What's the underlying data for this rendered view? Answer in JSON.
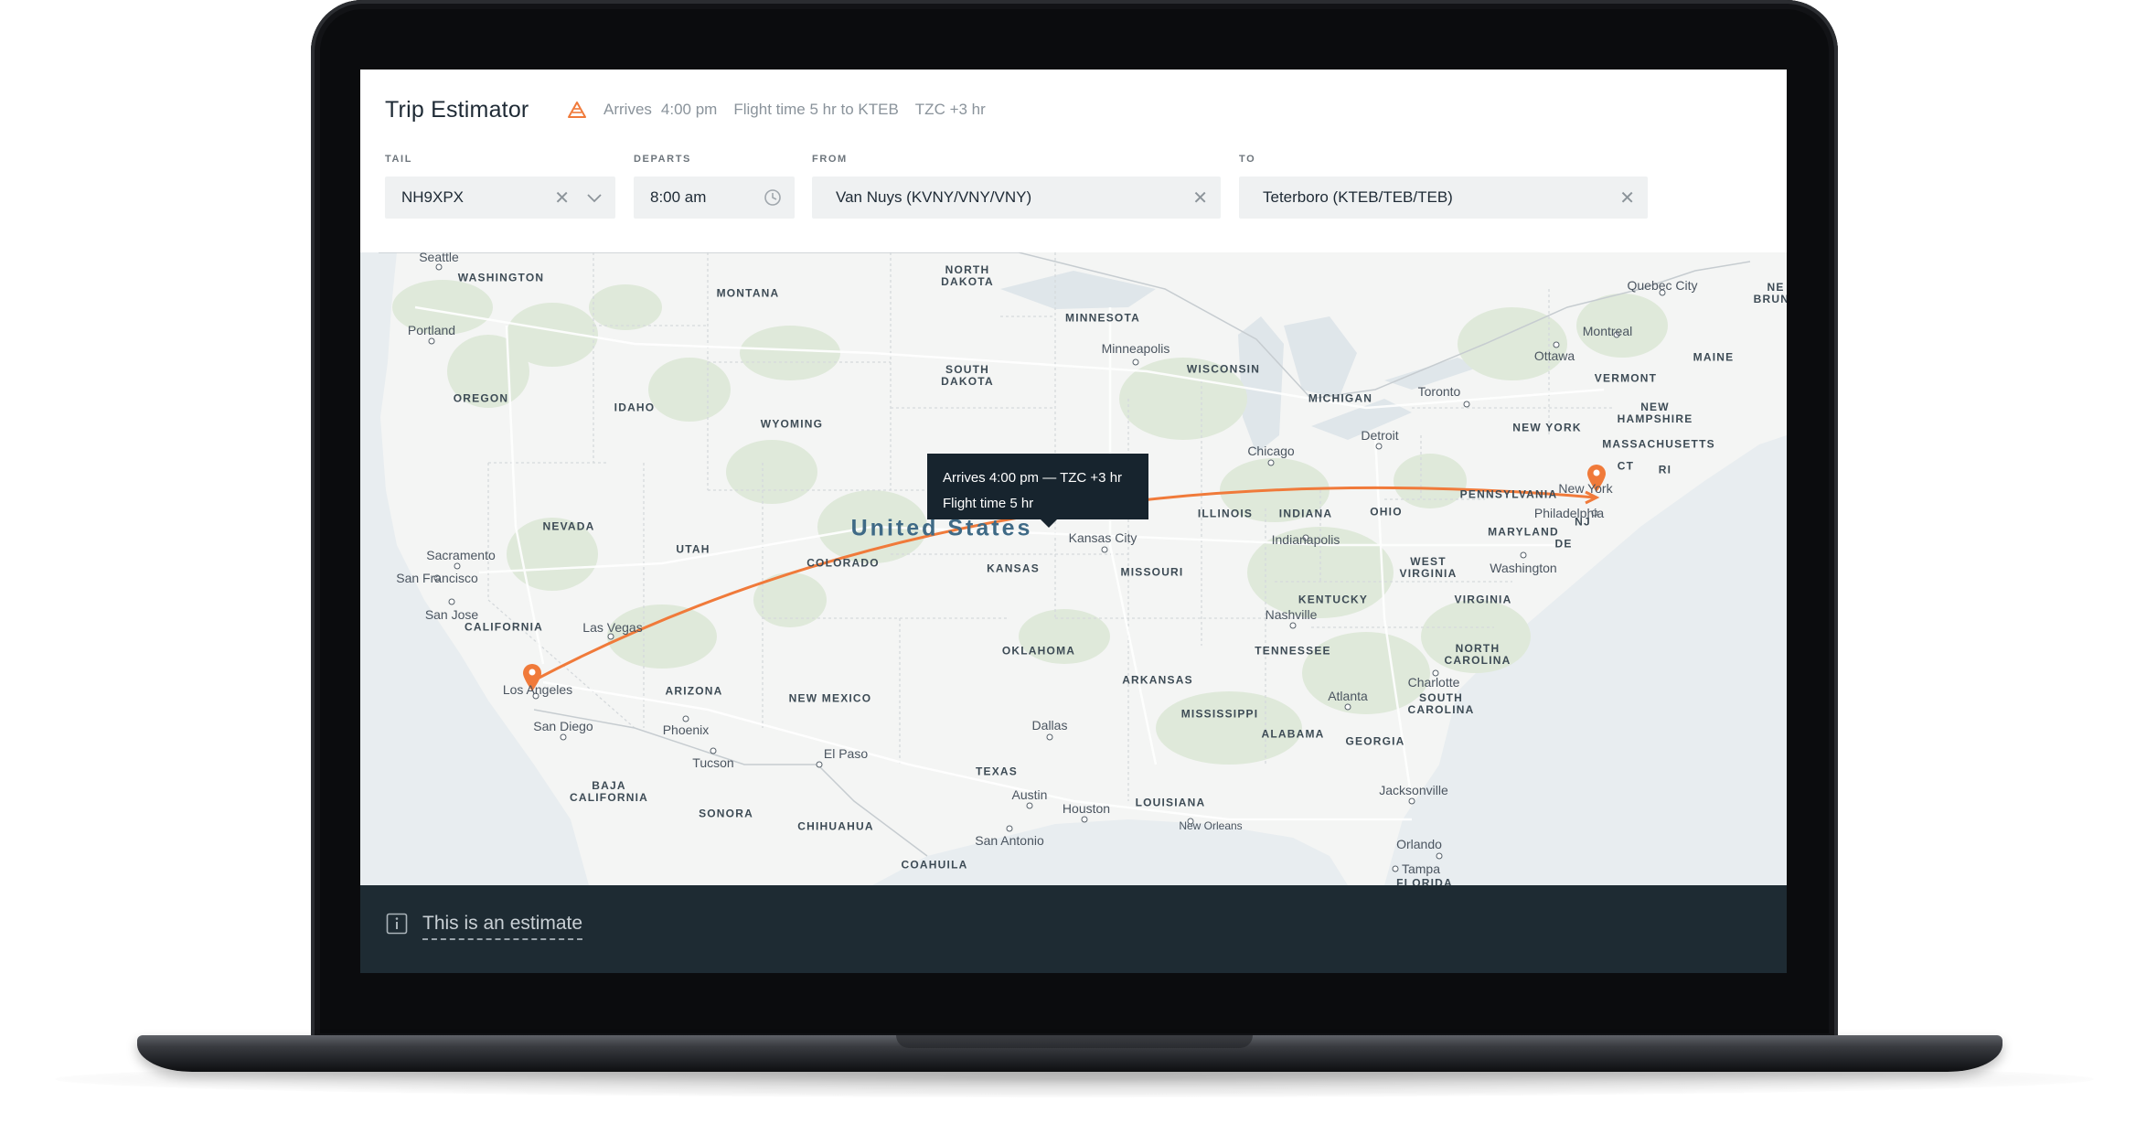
{
  "app": {
    "title": "Trip Estimator",
    "summary": {
      "arrives_label": "Arrives",
      "arrives_time": "4:00 pm",
      "flight_time": "Flight time 5 hr to KTEB",
      "tzc": "TZC +3 hr"
    }
  },
  "fields": {
    "tail": {
      "label": "TAIL",
      "value": "NH9XPX"
    },
    "departs": {
      "label": "DEPARTS",
      "value": "8:00 am"
    },
    "from": {
      "label": "FROM",
      "value": "Van Nuys (KVNY/VNY/VNY)"
    },
    "to": {
      "label": "TO",
      "value": "Teterboro (KTEB/TEB/TEB)"
    }
  },
  "map": {
    "country": "United States",
    "tooltip": {
      "line1": "Arrives 4:00 pm — TZC +3 hr",
      "line2": "Flight time 5 hr"
    },
    "states": {
      "washington": "WASHINGTON",
      "oregon": "OREGON",
      "idaho": "IDAHO",
      "montana": "MONTANA",
      "wyoming": "WYOMING",
      "north_dakota": "NORTH\nDAKOTA",
      "south_dakota": "SOUTH\nDAKOTA",
      "minnesota": "MINNESOTA",
      "wisconsin": "WISCONSIN",
      "michigan": "MICHIGAN",
      "nevada": "NEVADA",
      "utah": "UTAH",
      "colorado": "COLORADO",
      "kansas": "KANSAS",
      "california": "CALIFORNIA",
      "arizona": "ARIZONA",
      "new_mexico": "NEW MEXICO",
      "oklahoma": "OKLAHOMA",
      "texas": "TEXAS",
      "arkansas": "ARKANSAS",
      "missouri": "MISSOURI",
      "illinois": "ILLINOIS",
      "indiana": "INDIANA",
      "ohio": "OHIO",
      "kentucky": "KENTUCKY",
      "tennessee": "TENNESSEE",
      "mississippi": "MISSISSIPPI",
      "alabama": "ALABAMA",
      "georgia": "GEORGIA",
      "louisiana": "LOUISIANA",
      "west_virginia": "WEST\nVIRGINIA",
      "virginia": "VIRGINIA",
      "north_carolina": "NORTH\nCAROLINA",
      "south_carolina": "SOUTH\nCAROLINA",
      "pennsylvania": "PENNSYLVANIA",
      "new_york": "NEW YORK",
      "vermont": "VERMONT",
      "new_hampshire": "NEW\nHAMPSHIRE",
      "maine": "MAINE",
      "massachusetts": "MASSACHUSETTS",
      "ct": "CT",
      "ri": "RI",
      "nj": "NJ",
      "de": "DE",
      "maryland": "MARYLAND",
      "sonora": "SONORA",
      "chihuahua": "CHIHUAHUA",
      "coahuila": "COAHUILA",
      "baja_california": "BAJA\nCALIFORNIA",
      "florida": "FLORIDA",
      "new_brunswick": "NE\nBRUNS"
    },
    "cities": {
      "seattle": "Seattle",
      "portland": "Portland",
      "sacramento": "Sacramento",
      "san_francisco": "San Francisco",
      "san_jose": "San Jose",
      "las_vegas": "Las Vegas",
      "los_angeles": "Los Angeles",
      "san_diego": "San Diego",
      "phoenix": "Phoenix",
      "tucson": "Tucson",
      "el_paso": "El Paso",
      "dallas": "Dallas",
      "austin": "Austin",
      "houston": "Houston",
      "san_antonio": "San Antonio",
      "kansas_city": "Kansas City",
      "minneapolis": "Minneapolis",
      "chicago": "Chicago",
      "indianapolis": "Indianapolis",
      "nashville": "Nashville",
      "atlanta": "Atlanta",
      "charlotte": "Charlotte",
      "jacksonville": "Jacksonville",
      "orlando": "Orlando",
      "tampa": "Tampa",
      "new_orleans": "New Orleans",
      "detroit": "Detroit",
      "toronto": "Toronto",
      "ottawa": "Ottawa",
      "montreal": "Montreal",
      "quebec_city": "Quebec City",
      "new_york": "New York",
      "philadelphia": "Philadelphia",
      "washington": "Washington"
    }
  },
  "footer": {
    "estimate_text": "This is an estimate"
  },
  "colors": {
    "accent": "#f07a3a",
    "dark": "#1e2b33",
    "route": "#f07a3a"
  }
}
